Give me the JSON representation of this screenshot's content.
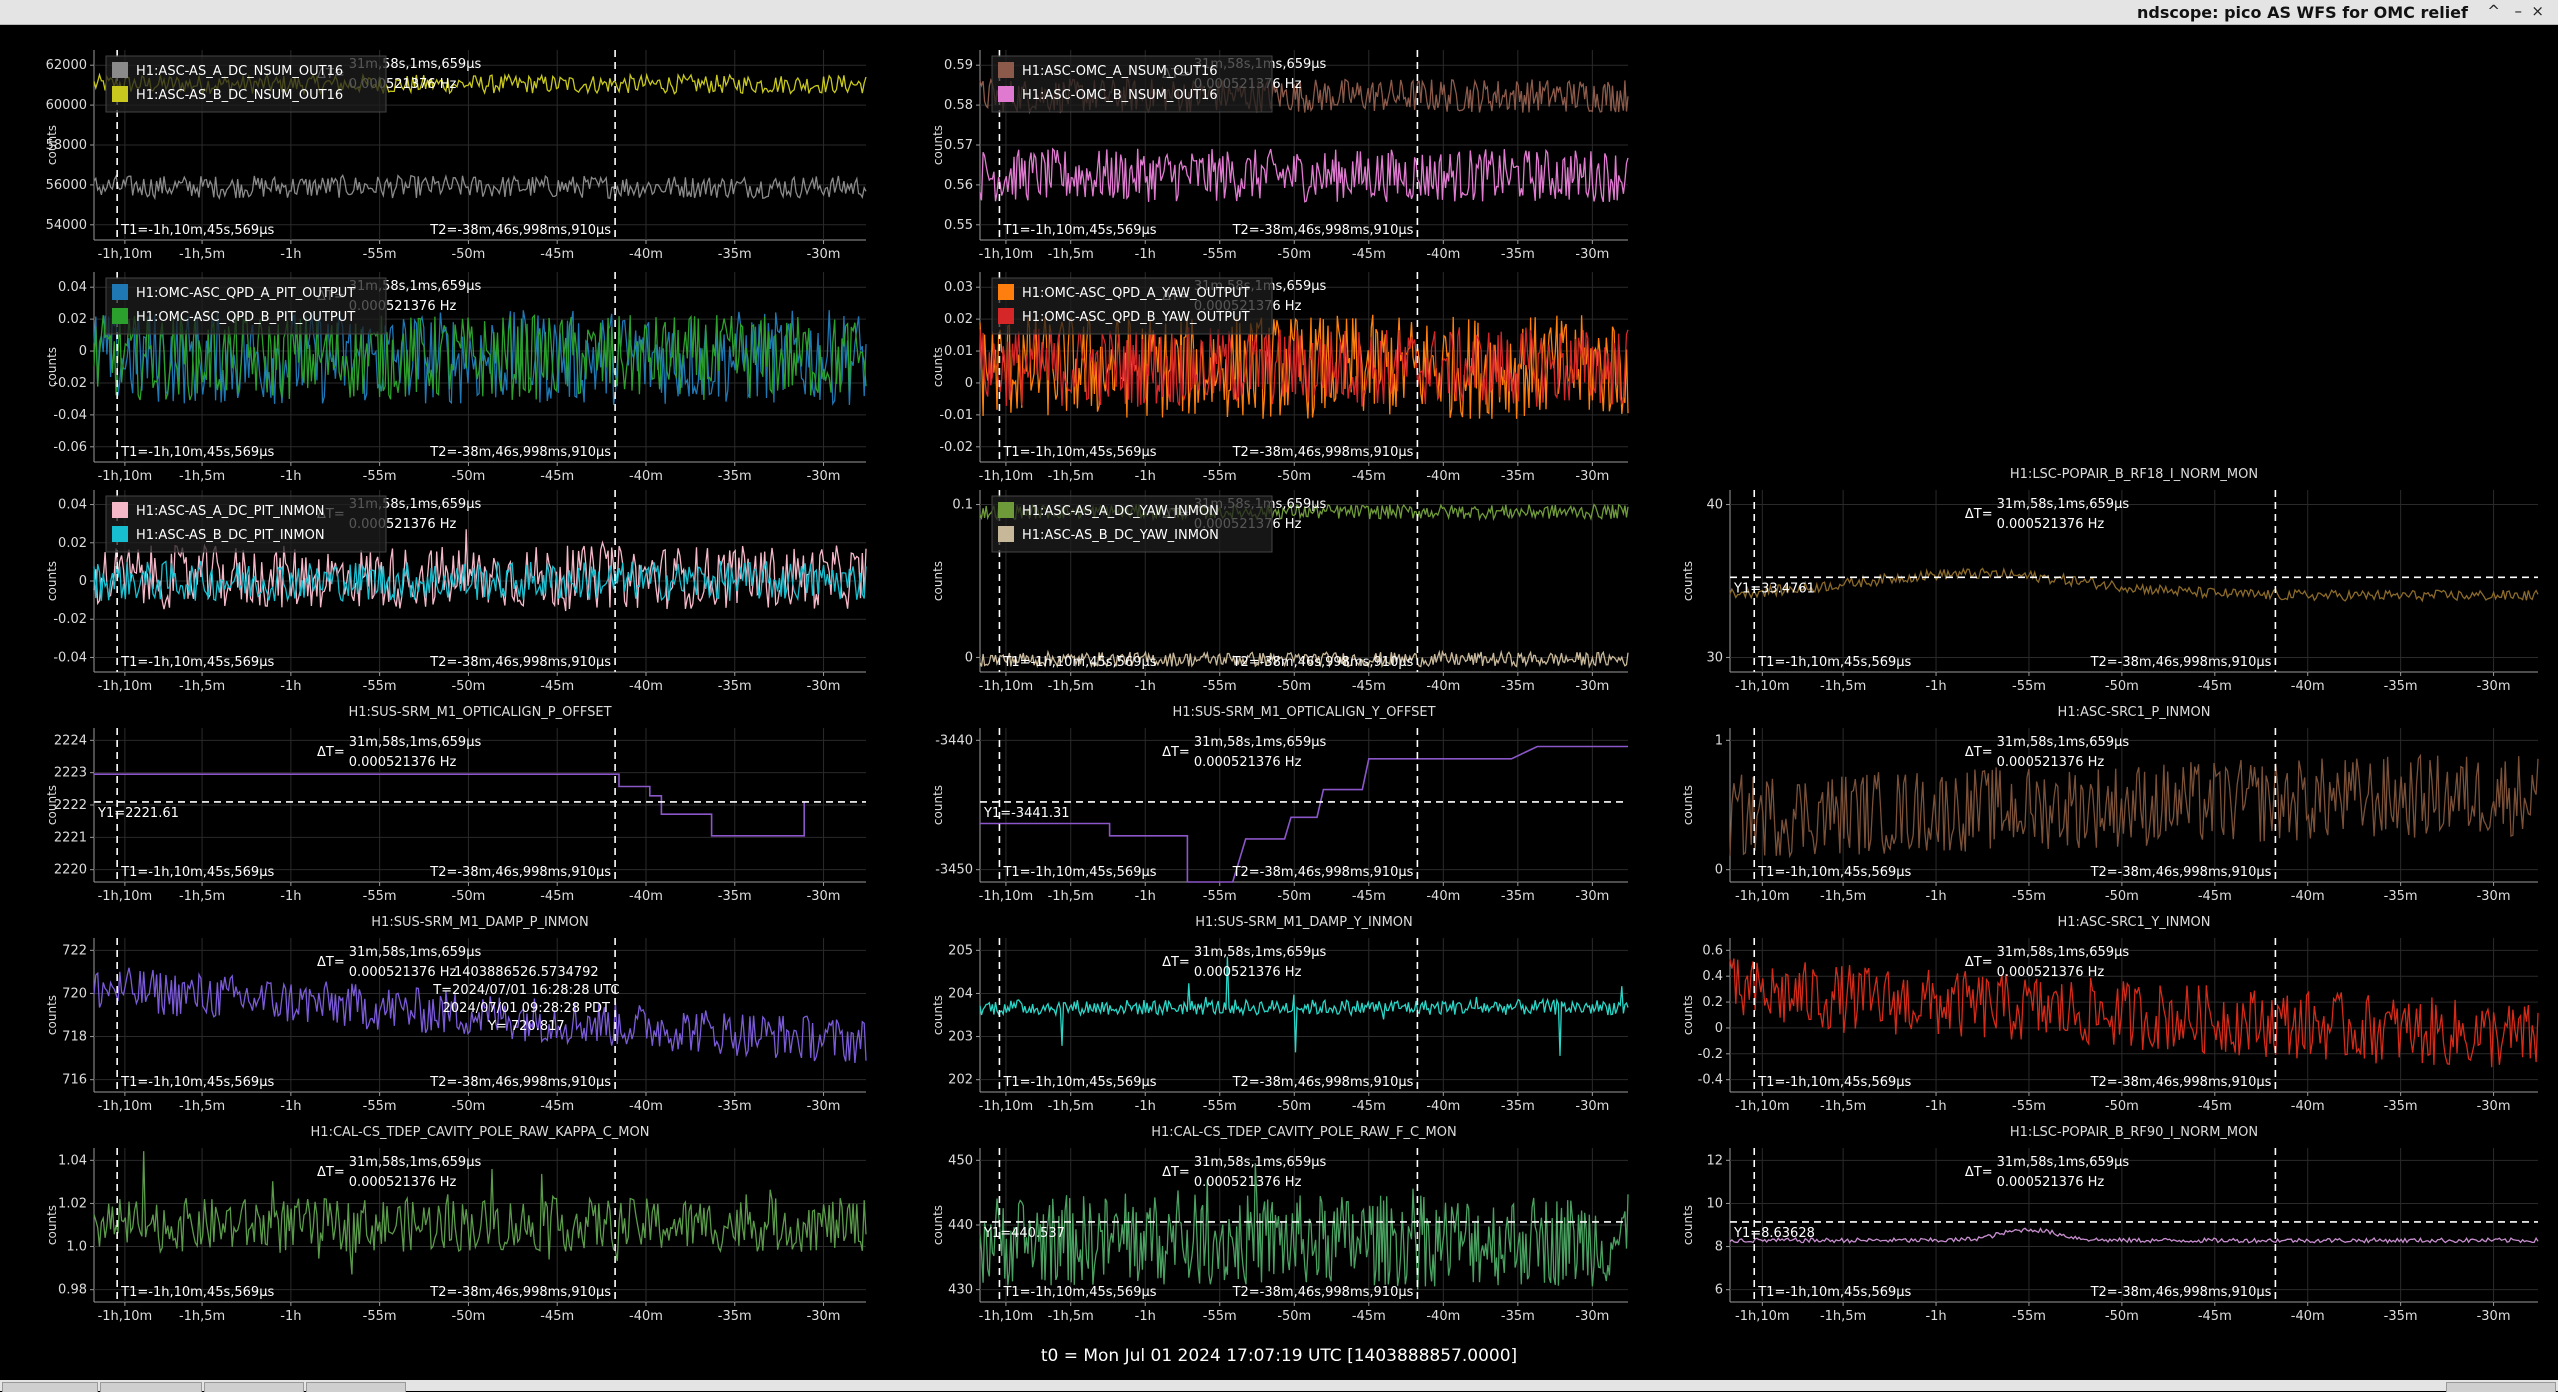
{
  "window": {
    "title": "ndscope: pico AS WFS for OMC relief",
    "controls": [
      "^",
      "–",
      "×"
    ]
  },
  "common": {
    "delta_t_label": "ΔT=",
    "delta_t_value": "31m,58s,1ms,659μs",
    "delta_f_value": "0.000521376 Hz",
    "t1_label": "T1=-1h,10m,45s,569μs",
    "t2_label": "T2=-38m,46s,998ms,910μs",
    "ylabel": "counts",
    "xticks_a": [
      "-1h,10m",
      "-1h,5m",
      "-1h",
      "-55m",
      "-50m",
      "-45m",
      "-40m",
      "-35m",
      "-30m"
    ]
  },
  "colors": {
    "background": "#000000",
    "axis": "#9a9a9a",
    "grid": "#2a2a2a",
    "cursor": "#ffffff",
    "yellow": "#c8c81e",
    "gray": "#8a8a8a",
    "brown": "#8b5a4a",
    "pink": "#e07ad0",
    "blue": "#1f77b4",
    "green": "#2ca02c",
    "orange": "#ff7f0e",
    "red": "#d62728",
    "lightpink": "#f4b8c8",
    "cyan": "#17becf",
    "olive": "#6f9a3a",
    "tan": "#c8b89a",
    "gold": "#8b6a2a",
    "purple": "#8a56c8",
    "purple2": "#7a5ad6",
    "teal": "#2ad6c8",
    "red2": "#d42a18",
    "green2": "#5a9a4a",
    "green3": "#4aa060",
    "pink2": "#c890d0",
    "brown2": "#7a5038"
  },
  "plots": [
    {
      "id": "omc-nsum-dc",
      "legend": [
        "H1:ASC-AS_A_DC_NSUM_OUT16",
        "H1:ASC-AS_B_DC_NSUM_OUT16"
      ],
      "legend_colors": [
        "gray",
        "yellow"
      ],
      "yticks": [
        "62000",
        "60000",
        "58000",
        "56000",
        "54000"
      ]
    },
    {
      "id": "omc-nsum-a-b",
      "legend": [
        "H1:ASC-OMC_A_NSUM_OUT16",
        "H1:ASC-OMC_B_NSUM_OUT16"
      ],
      "legend_colors": [
        "brown",
        "pink"
      ],
      "yticks": [
        "0.59",
        "0.58",
        "0.57",
        "0.56",
        "0.55"
      ]
    },
    {
      "id": "qpd-pit",
      "legend": [
        "H1:OMC-ASC_QPD_A_PIT_OUTPUT",
        "H1:OMC-ASC_QPD_B_PIT_OUTPUT"
      ],
      "legend_colors": [
        "blue",
        "green"
      ],
      "yticks": [
        "0.04",
        "0.02",
        "0",
        "-0.02",
        "-0.04",
        "-0.06"
      ]
    },
    {
      "id": "qpd-yaw",
      "legend": [
        "H1:OMC-ASC_QPD_A_YAW_OUTPUT",
        "H1:OMC-ASC_QPD_B_YAW_OUTPUT"
      ],
      "legend_colors": [
        "orange",
        "red"
      ],
      "yticks": [
        "0.03",
        "0.02",
        "0.01",
        "0",
        "-0.01",
        "-0.02"
      ]
    },
    {
      "id": "dc-pit-inmon",
      "legend": [
        "H1:ASC-AS_A_DC_PIT_INMON",
        "H1:ASC-AS_B_DC_PIT_INMON"
      ],
      "legend_colors": [
        "lightpink",
        "cyan"
      ],
      "yticks": [
        "0.04",
        "0.02",
        "0",
        "-0.02",
        "-0.04"
      ]
    },
    {
      "id": "dc-yaw-inmon",
      "legend": [
        "H1:ASC-AS_A_DC_YAW_INMON",
        "H1:ASC-AS_B_DC_YAW_INMON"
      ],
      "legend_colors": [
        "olive",
        "tan"
      ],
      "yticks": [
        "0.1",
        "0"
      ]
    },
    {
      "id": "popair-rf18",
      "title": "H1:LSC-POPAIR_B_RF18_I_NORM_MON",
      "yticks": [
        "40",
        "30"
      ],
      "y_readout": "Y1=33.4761"
    },
    {
      "id": "srm-p-offset",
      "title": "H1:SUS-SRM_M1_OPTICALIGN_P_OFFSET",
      "yticks": [
        "2224",
        "2223",
        "2222",
        "2221",
        "2220"
      ],
      "y_readout": "Y1=2221.61"
    },
    {
      "id": "srm-y-offset",
      "title": "H1:SUS-SRM_M1_OPTICALIGN_Y_OFFSET",
      "yticks": [
        "-3440",
        "-3450"
      ],
      "y_readout": "Y1=-3441.31"
    },
    {
      "id": "src1-p",
      "title": "H1:ASC-SRC1_P_INMON",
      "yticks": [
        "1",
        "0"
      ]
    },
    {
      "id": "srm-damp-p",
      "title": "H1:SUS-SRM_M1_DAMP_P_INMON",
      "yticks": [
        "722",
        "720",
        "718",
        "716"
      ],
      "hover": [
        "1403886526.5734792",
        "T=2024/07/01 16:28:28 UTC",
        "2024/07/01 09:28:28 PDT",
        "Y= 720.817"
      ]
    },
    {
      "id": "srm-damp-y",
      "title": "H1:SUS-SRM_M1_DAMP_Y_INMON",
      "yticks": [
        "205",
        "204",
        "203",
        "202"
      ]
    },
    {
      "id": "src1-y",
      "title": "H1:ASC-SRC1_Y_INMON",
      "yticks": [
        "0.6",
        "0.4",
        "0.2",
        "0",
        "-0.2",
        "-0.4"
      ]
    },
    {
      "id": "kappa-c",
      "title": "H1:CAL-CS_TDEP_CAVITY_POLE_RAW_KAPPA_C_MON",
      "yticks": [
        "1.04",
        "1.02",
        "1.0",
        "0.98"
      ]
    },
    {
      "id": "f-c",
      "title": "H1:CAL-CS_TDEP_CAVITY_POLE_RAW_F_C_MON",
      "yticks": [
        "450",
        "440",
        "430"
      ],
      "y_readout": "Y1=440.537"
    },
    {
      "id": "popair-rf90",
      "title": "H1:LSC-POPAIR_B_RF90_I_NORM_MON",
      "yticks": [
        "12",
        "10",
        "8",
        "6"
      ],
      "y_readout": "Y1=8.63628"
    }
  ],
  "footer": {
    "t0": "t0 = Mon Jul 01 2024 17:07:19 UTC [1403888857.0000]"
  }
}
